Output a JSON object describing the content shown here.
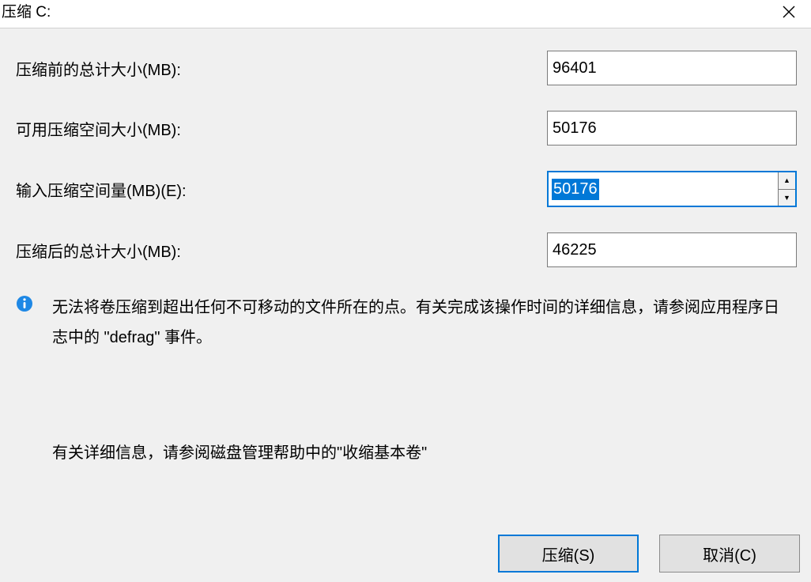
{
  "window": {
    "title": "压缩 C:",
    "close_label": "关闭"
  },
  "fields": {
    "total_before": {
      "label": "压缩前的总计大小(MB):",
      "value": "96401"
    },
    "available": {
      "label": "可用压缩空间大小(MB):",
      "value": "50176"
    },
    "input": {
      "label": "输入压缩空间量(MB)(E):",
      "value": "50176"
    },
    "total_after": {
      "label": "压缩后的总计大小(MB):",
      "value": "46225"
    }
  },
  "info": {
    "icon": "info-icon",
    "text": "无法将卷压缩到超出任何不可移动的文件所在的点。有关完成该操作时间的详细信息，请参阅应用程序日志中的 \"defrag\" 事件。"
  },
  "help": {
    "text": "有关详细信息，请参阅磁盘管理帮助中的\"收缩基本卷\""
  },
  "buttons": {
    "shrink": "压缩(S)",
    "cancel": "取消(C)"
  }
}
